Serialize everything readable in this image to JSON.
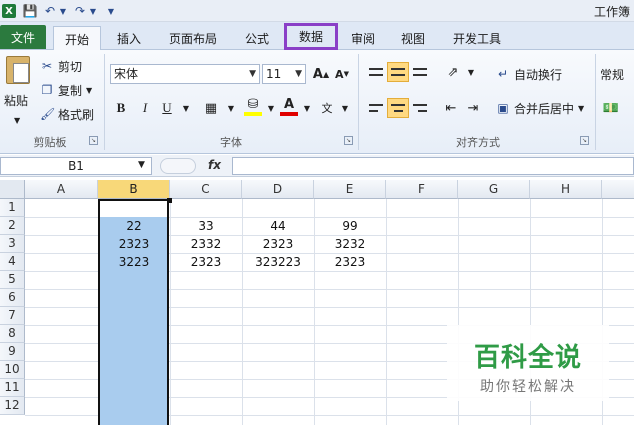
{
  "window": {
    "title": "工作簿"
  },
  "quick_access": {
    "app_icon": "X",
    "save_icon": "save-icon",
    "undo_icon": "undo-icon",
    "redo_icon": "redo-icon"
  },
  "tabs": [
    {
      "label": "文件"
    },
    {
      "label": "开始"
    },
    {
      "label": "插入"
    },
    {
      "label": "页面布局"
    },
    {
      "label": "公式"
    },
    {
      "label": "数据"
    },
    {
      "label": "审阅"
    },
    {
      "label": "视图"
    },
    {
      "label": "开发工具"
    }
  ],
  "ribbon": {
    "clipboard": {
      "paste": "粘贴",
      "cut": "剪切",
      "copy": "复制",
      "format_painter": "格式刷",
      "group": "剪贴板"
    },
    "font": {
      "name": "宋体",
      "size": "11",
      "bold": "B",
      "italic": "I",
      "underline": "U",
      "group": "字体"
    },
    "alignment": {
      "wrap": "自动换行",
      "merge": "合并后居中",
      "group": "对齐方式"
    },
    "number": {
      "format": "常规"
    }
  },
  "formula_bar": {
    "name_box": "B1",
    "fx": "fx"
  },
  "columns": [
    "A",
    "B",
    "C",
    "D",
    "E",
    "F",
    "G",
    "H"
  ],
  "rows": [
    "1",
    "2",
    "3",
    "4",
    "5",
    "6",
    "7",
    "8",
    "9",
    "10",
    "11",
    "12"
  ],
  "cells": {
    "r2": [
      "22",
      "33",
      "44",
      "99"
    ],
    "r3": [
      "2323",
      "2332",
      "2323",
      "3232"
    ],
    "r4": [
      "3223",
      "2323",
      "323223",
      "2323"
    ]
  },
  "watermark": {
    "main": "百科全说",
    "sub": "助你轻松解决"
  },
  "colors": {
    "file_tab": "#2b7a3e",
    "highlight_border": "#8a3fc7",
    "selection": "#a9ccee",
    "header_selected": "#f8d879"
  }
}
